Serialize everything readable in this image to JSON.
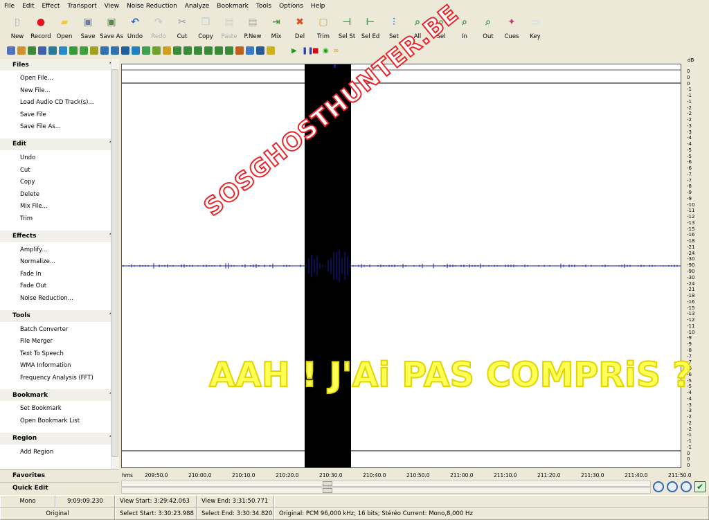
{
  "menu": [
    "File",
    "Edit",
    "Effect",
    "Transport",
    "View",
    "Noise Reduction",
    "Analyze",
    "Bookmark",
    "Tools",
    "Options",
    "Help"
  ],
  "toolbar": [
    {
      "label": "New",
      "icon": "new-file-icon",
      "color": "#ffffff",
      "enabled": true
    },
    {
      "label": "Record",
      "icon": "record-icon",
      "color": "#e0141a",
      "enabled": true
    },
    {
      "label": "Open",
      "icon": "open-folder-icon",
      "color": "#f5c34a",
      "enabled": true
    },
    {
      "label": "Save",
      "icon": "save-icon",
      "color": "#6e7ea0",
      "enabled": true
    },
    {
      "label": "Save As",
      "icon": "save-as-icon",
      "color": "#5a8a4a",
      "enabled": true
    },
    {
      "label": "Undo",
      "icon": "undo-icon",
      "color": "#2e64b8",
      "enabled": true
    },
    {
      "label": "Redo",
      "icon": "redo-icon",
      "color": "#c8c8c8",
      "enabled": false
    },
    {
      "label": "Cut",
      "icon": "cut-icon",
      "color": "#8a9bb8",
      "enabled": true
    },
    {
      "label": "Copy",
      "icon": "copy-icon",
      "color": "#b8c8e4",
      "enabled": true
    },
    {
      "label": "Paste",
      "icon": "paste-icon",
      "color": "#d0d0d0",
      "enabled": false
    },
    {
      "label": "P.New",
      "icon": "paste-new-icon",
      "color": "#9ab0d0",
      "enabled": true
    },
    {
      "label": "Mix",
      "icon": "mix-icon",
      "color": "#3f9c3a",
      "enabled": true
    },
    {
      "label": "Del",
      "icon": "delete-icon",
      "color": "#e24a1c",
      "enabled": true
    },
    {
      "label": "Trim",
      "icon": "trim-icon",
      "color": "#d8a040",
      "enabled": true
    },
    {
      "label": "Sel St",
      "icon": "select-start-icon",
      "color": "#4c9a5a",
      "enabled": true
    },
    {
      "label": "Sel Ed",
      "icon": "select-end-icon",
      "color": "#4c9a5a",
      "enabled": true
    },
    {
      "label": "Set",
      "icon": "set-icon",
      "color": "#3a7ac8",
      "enabled": true
    },
    {
      "label": "All",
      "icon": "zoom-all-icon",
      "color": "#3e9040",
      "enabled": true
    },
    {
      "label": "Sel",
      "icon": "zoom-selection-icon",
      "color": "#3e9040",
      "enabled": true
    },
    {
      "label": "In",
      "icon": "zoom-in-icon",
      "color": "#3e9040",
      "enabled": true
    },
    {
      "label": "Out",
      "icon": "zoom-out-icon",
      "color": "#3e9040",
      "enabled": true
    },
    {
      "label": "Cues",
      "icon": "cues-icon",
      "color": "#c04080",
      "enabled": true
    },
    {
      "label": "Key",
      "icon": "key-icon",
      "color": "#d0d8e8",
      "enabled": true
    }
  ],
  "sidebar": {
    "sections": [
      {
        "title": "Files",
        "items": [
          "Open File...",
          "New File...",
          "Load Audio CD Track(s)...",
          "Save File",
          "Save File As..."
        ]
      },
      {
        "title": "Edit",
        "items": [
          "Undo",
          "Cut",
          "Copy",
          "Delete",
          "Mix File...",
          "Trim"
        ]
      },
      {
        "title": "Effects",
        "items": [
          "Amplify...",
          "Normalize...",
          "Fade In",
          "Fade Out",
          "Noise Reduction..."
        ]
      },
      {
        "title": "Tools",
        "items": [
          "Batch Converter",
          "File Merger",
          "Text To Speech",
          "WMA Information",
          "Frequency Analysis (FFT)"
        ]
      },
      {
        "title": "Bookmark",
        "items": [
          "Set Bookmark",
          "Open Bookmark List"
        ]
      },
      {
        "title": "Region",
        "items": [
          "Add Region"
        ]
      }
    ],
    "favorites": "Favorites",
    "quick_edit": "Quick Edit"
  },
  "timeline": {
    "unit": "hms",
    "ticks": [
      "209:50.0",
      "210:00.0",
      "210:10.0",
      "210:20.0",
      "210:30.0",
      "210:40.0",
      "210:50.0",
      "211:00.0",
      "211:10.0",
      "211:20.0",
      "211:30.0",
      "211:40.0",
      "211:50.0"
    ]
  },
  "db_scale": {
    "unit": "dB",
    "labels": [
      "0",
      "0",
      "0",
      "-1",
      "-1",
      "-1",
      "-2",
      "-2",
      "-2",
      "-3",
      "-3",
      "-4",
      "-4",
      "-5",
      "-5",
      "-6",
      "-6",
      "-7",
      "-7",
      "-8",
      "-9",
      "-9",
      "-10",
      "-11",
      "-12",
      "-13",
      "-15",
      "-16",
      "-18",
      "-21",
      "-24",
      "-30",
      "-90",
      "-90",
      "-30",
      "-24",
      "-21",
      "-18",
      "-16",
      "-15",
      "-13",
      "-12",
      "-11",
      "-10",
      "-9",
      "-9",
      "-8",
      "-7",
      "-7",
      "-6",
      "-6",
      "-5",
      "-5",
      "-4",
      "-4",
      "-3",
      "-3",
      "-2",
      "-2",
      "-2",
      "-1",
      "-1",
      "-1",
      "0",
      "0",
      "0"
    ]
  },
  "overlays": {
    "watermark": "SOSGHOSTHUNTER.BE",
    "caption": "AAH ! J'Ai PAS COMPRiS ?"
  },
  "status": {
    "channel_mode": "Mono",
    "duration": "9:09:09.230",
    "view_start": "View Start: 3:29:42.063",
    "view_end": "View End: 3:31:50.771",
    "state": "Original",
    "select_start": "Select Start: 3:30:23.988",
    "select_end": "Select End: 3:30:34.820",
    "format": "Original: PCM 96,000 kHz; 16 bits; Stéréo Current: Mono,8,000 Hz"
  },
  "colors": {
    "selection": "#000000",
    "waveform": "#1a1aa0",
    "watermark": "#e8262a",
    "caption": "#ffff55"
  }
}
